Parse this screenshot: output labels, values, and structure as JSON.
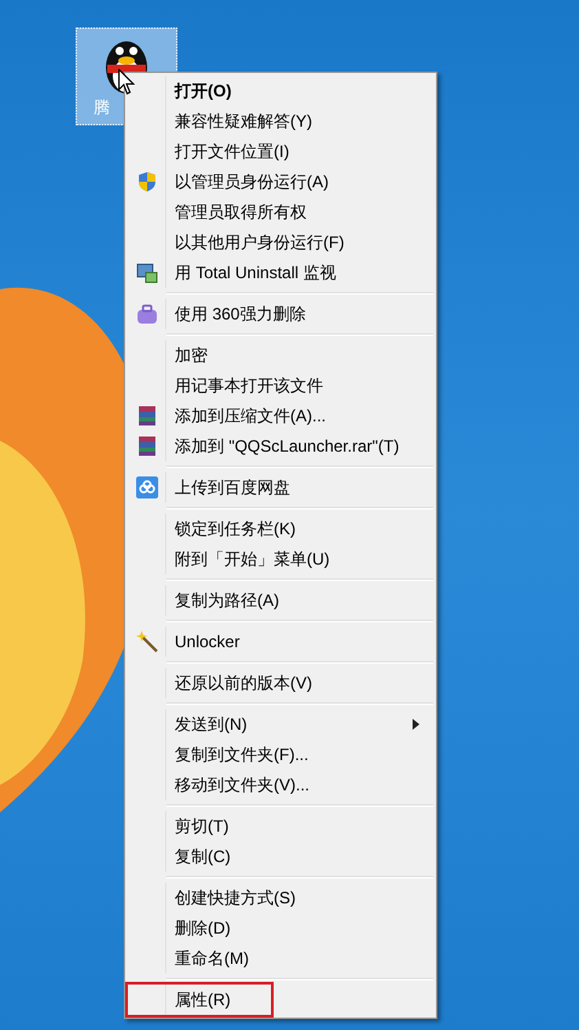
{
  "desktop": {
    "icon": {
      "label": "腾",
      "selected": true
    }
  },
  "context_menu": {
    "groups": [
      {
        "items": [
          {
            "label": "打开(O)",
            "kind": "plain",
            "default": true,
            "submenu": false,
            "highlighted": false
          },
          {
            "label": "兼容性疑难解答(Y)",
            "kind": "plain",
            "default": false,
            "submenu": false,
            "highlighted": false
          },
          {
            "label": "打开文件位置(I)",
            "kind": "plain",
            "default": false,
            "submenu": false,
            "highlighted": false
          },
          {
            "label": "以管理员身份运行(A)",
            "kind": "shield",
            "default": false,
            "submenu": false,
            "highlighted": false
          },
          {
            "label": "管理员取得所有权",
            "kind": "plain",
            "default": false,
            "submenu": false,
            "highlighted": false
          },
          {
            "label": "以其他用户身份运行(F)",
            "kind": "plain",
            "default": false,
            "submenu": false,
            "highlighted": false
          },
          {
            "label": "用 Total Uninstall 监视",
            "kind": "monitor",
            "default": false,
            "submenu": false,
            "highlighted": false
          }
        ]
      },
      {
        "items": [
          {
            "label": "使用 360强力删除",
            "kind": "toolbox",
            "default": false,
            "submenu": false,
            "highlighted": false
          }
        ]
      },
      {
        "items": [
          {
            "label": "加密",
            "kind": "plain",
            "default": false,
            "submenu": false,
            "highlighted": false
          },
          {
            "label": "用记事本打开该文件",
            "kind": "plain",
            "default": false,
            "submenu": false,
            "highlighted": false
          },
          {
            "label": "添加到压缩文件(A)...",
            "kind": "archive",
            "default": false,
            "submenu": false,
            "highlighted": false
          },
          {
            "label": "添加到 \"QQScLauncher.rar\"(T)",
            "kind": "archive",
            "default": false,
            "submenu": false,
            "highlighted": false
          }
        ]
      },
      {
        "items": [
          {
            "label": "上传到百度网盘",
            "kind": "cloud",
            "default": false,
            "submenu": false,
            "highlighted": false
          }
        ]
      },
      {
        "items": [
          {
            "label": "锁定到任务栏(K)",
            "kind": "plain",
            "default": false,
            "submenu": false,
            "highlighted": false
          },
          {
            "label": "附到「开始」菜单(U)",
            "kind": "plain",
            "default": false,
            "submenu": false,
            "highlighted": false
          }
        ]
      },
      {
        "items": [
          {
            "label": "复制为路径(A)",
            "kind": "plain",
            "default": false,
            "submenu": false,
            "highlighted": false
          }
        ]
      },
      {
        "items": [
          {
            "label": "Unlocker",
            "kind": "wand",
            "default": false,
            "submenu": false,
            "highlighted": false
          }
        ]
      },
      {
        "items": [
          {
            "label": "还原以前的版本(V)",
            "kind": "plain",
            "default": false,
            "submenu": false,
            "highlighted": false
          }
        ]
      },
      {
        "items": [
          {
            "label": "发送到(N)",
            "kind": "plain",
            "default": false,
            "submenu": true,
            "highlighted": false
          },
          {
            "label": "复制到文件夹(F)...",
            "kind": "plain",
            "default": false,
            "submenu": false,
            "highlighted": false
          },
          {
            "label": "移动到文件夹(V)...",
            "kind": "plain",
            "default": false,
            "submenu": false,
            "highlighted": false
          }
        ]
      },
      {
        "items": [
          {
            "label": "剪切(T)",
            "kind": "plain",
            "default": false,
            "submenu": false,
            "highlighted": false
          },
          {
            "label": "复制(C)",
            "kind": "plain",
            "default": false,
            "submenu": false,
            "highlighted": false
          }
        ]
      },
      {
        "items": [
          {
            "label": "创建快捷方式(S)",
            "kind": "plain",
            "default": false,
            "submenu": false,
            "highlighted": false
          },
          {
            "label": "删除(D)",
            "kind": "plain",
            "default": false,
            "submenu": false,
            "highlighted": false
          },
          {
            "label": "重命名(M)",
            "kind": "plain",
            "default": false,
            "submenu": false,
            "highlighted": false
          }
        ]
      },
      {
        "items": [
          {
            "label": "属性(R)",
            "kind": "plain",
            "default": false,
            "submenu": false,
            "highlighted": true
          }
        ]
      }
    ]
  }
}
